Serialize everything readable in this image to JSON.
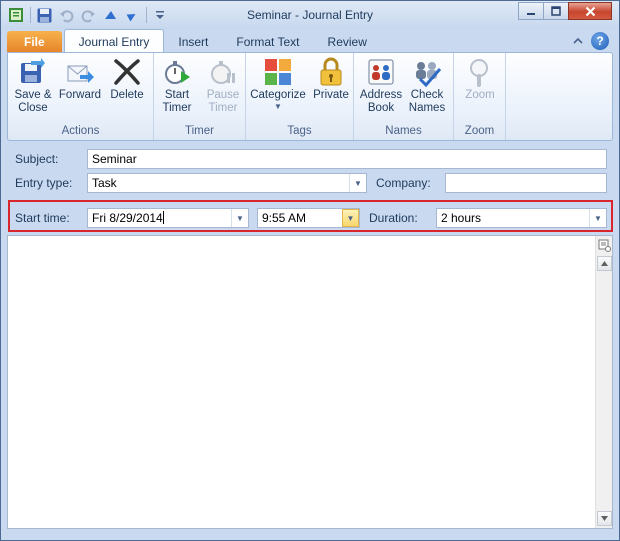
{
  "window": {
    "title": "Seminar  - Journal Entry"
  },
  "qat": {
    "icons": [
      "app-icon",
      "save-icon",
      "undo-icon",
      "redo-icon",
      "previous-item-icon",
      "next-item-icon",
      "customize-qat-icon"
    ]
  },
  "tabs": {
    "file": "File",
    "journal_entry": "Journal Entry",
    "insert": "Insert",
    "format_text": "Format Text",
    "review": "Review"
  },
  "ribbon": {
    "actions": {
      "label": "Actions",
      "save_close": "Save &\nClose",
      "forward": "Forward",
      "delete": "Delete"
    },
    "timer": {
      "label": "Timer",
      "start_timer": "Start\nTimer",
      "pause_timer": "Pause\nTimer"
    },
    "tags": {
      "label": "Tags",
      "categorize": "Categorize",
      "private": "Private"
    },
    "names": {
      "label": "Names",
      "address_book": "Address\nBook",
      "check_names": "Check\nNames"
    },
    "zoom": {
      "label": "Zoom",
      "zoom": "Zoom"
    }
  },
  "form": {
    "subject_label": "Subject:",
    "subject_value": "Seminar",
    "entry_type_label": "Entry type:",
    "entry_type_value": "Task",
    "company_label": "Company:",
    "company_value": "",
    "start_time_label": "Start time:",
    "start_date_value": "Fri 8/29/2014",
    "start_time_value": "9:55 AM",
    "duration_label": "Duration:",
    "duration_value": "2 hours"
  },
  "colors": {
    "window_frame": "#c9daf0",
    "file_tab": "#e6832a",
    "highlight_border": "#d9262c",
    "close_button": "#c7452e"
  }
}
